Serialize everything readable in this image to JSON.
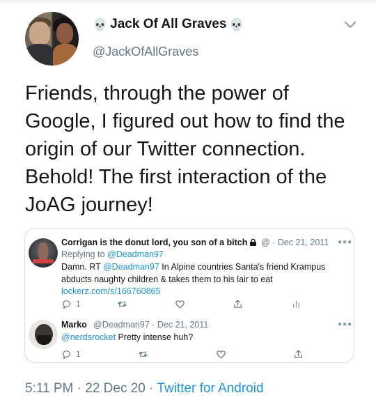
{
  "author": {
    "display_name": "Jack Of All Graves",
    "prefix_emoji": "💀",
    "suffix_emoji": "💀",
    "handle": "@JackOfAllGraves"
  },
  "tweet": {
    "text": "Friends, through the power of Google, I figured out how to find the origin of our Twitter connection. Behold! The first interaction of the JoAG journey!"
  },
  "embedded": {
    "first": {
      "name": "Corrigan is the donut lord, you son of a bitch",
      "handle": "@",
      "date": "Dec 21, 2011",
      "replying_label": "Replying to",
      "replying_to": "@Deadman97",
      "text_lead": "Damn. RT ",
      "mention": "@Deadman97",
      "text_rest": " In Alpine countries Santa's friend Krampus abducts naughty children & takes them to his lair to eat",
      "link": "lockerz.com/s/166760865",
      "reply_count": "1"
    },
    "second": {
      "name": "Marko",
      "handle": "@Deadman97",
      "date": "Dec 21, 2011",
      "mention": "@nerdsrocket",
      "text": " Pretty intense huh?",
      "reply_count": "1"
    }
  },
  "footer": {
    "time": "5:11 PM",
    "date": "22 Dec 20",
    "source": "Twitter for Android"
  },
  "colors": {
    "link": "#1b95e0",
    "muted": "#657786",
    "border": "#d6dde3"
  },
  "icons": [
    "skull-emoji",
    "chevron-down-icon",
    "lock-icon",
    "more-icon",
    "reply-icon",
    "retweet-icon",
    "like-icon",
    "share-icon",
    "analytics-icon"
  ]
}
